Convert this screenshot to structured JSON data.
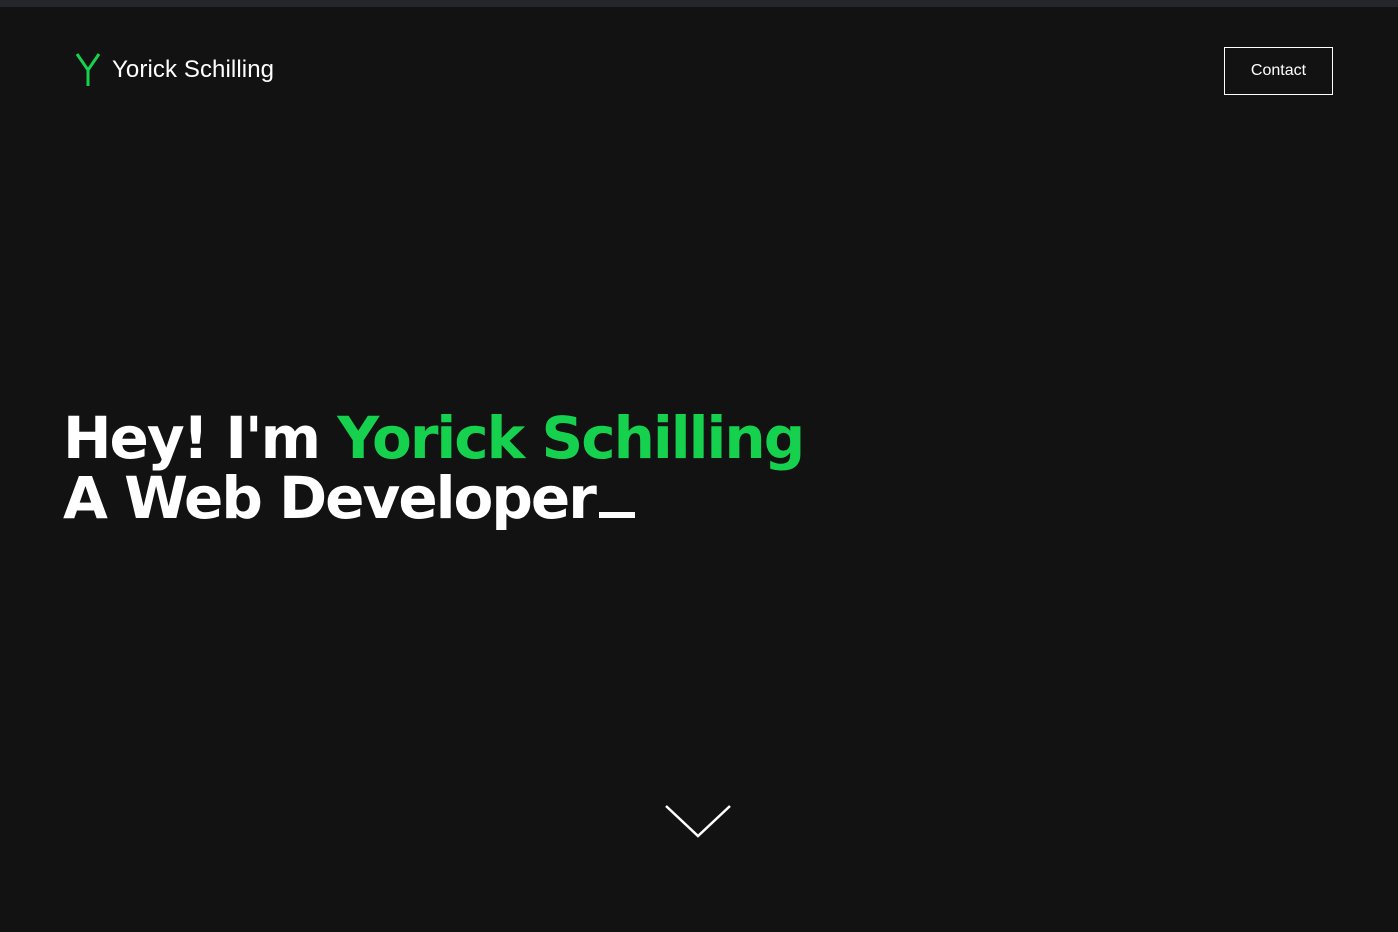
{
  "header": {
    "brand_name": "Yorick Schilling",
    "logo_icon": "y-logo-icon",
    "contact_label": "Contact"
  },
  "hero": {
    "greeting": "Hey! I'm ",
    "name": "Yorick Schilling",
    "role": "A Web Developer",
    "cursor_char": "_"
  },
  "scroll": {
    "icon": "chevron-down-icon"
  },
  "colors": {
    "background": "#121212",
    "accent": "#16d14e",
    "text": "#ffffff"
  }
}
